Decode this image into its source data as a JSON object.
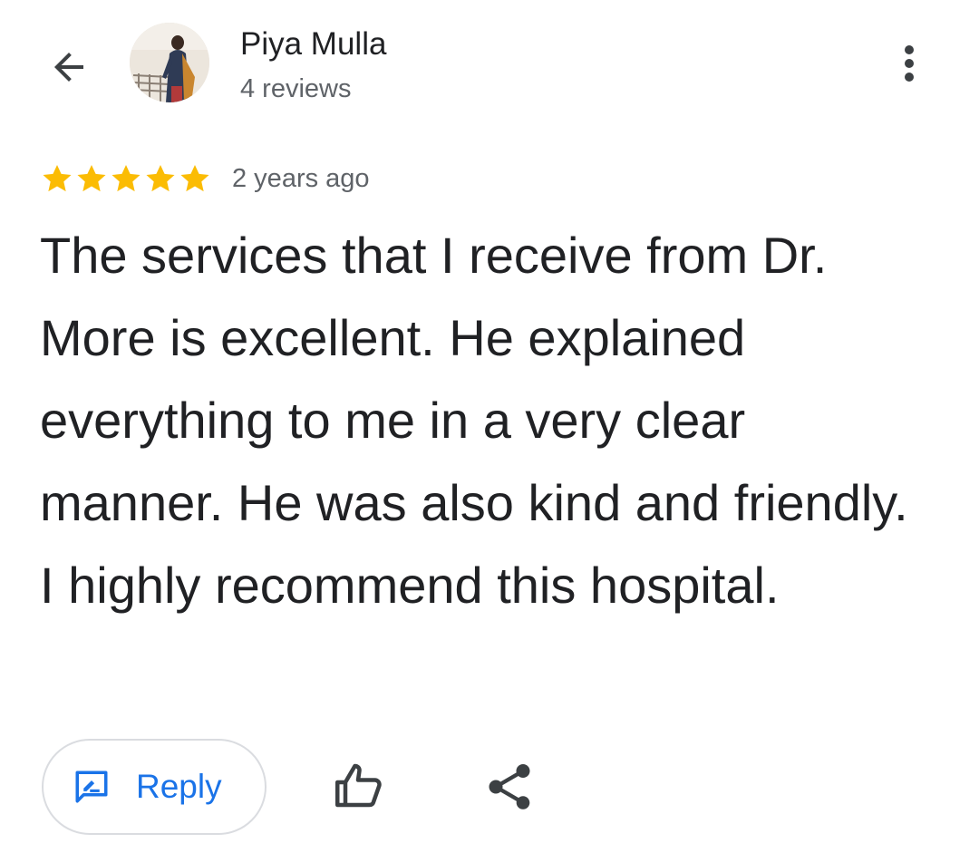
{
  "header": {
    "author_name": "Piya Mulla",
    "author_reviews": "4 reviews",
    "back_icon": "arrow-back-icon",
    "more_icon": "more-vert-icon"
  },
  "review": {
    "rating": 5,
    "rating_max": 5,
    "date": "2 years ago",
    "text": "The services that I receive from Dr. More is excellent. He explained everything to me in a very clear manner. He was also kind and friendly. I highly recommend this hospital."
  },
  "actions": {
    "reply_label": "Reply",
    "reply_icon": "rate-review-icon",
    "like_icon": "thumb-up-icon",
    "share_icon": "share-icon"
  },
  "colors": {
    "star": "#fbbc04",
    "accent": "#1a73e8",
    "text_primary": "#202124",
    "text_secondary": "#5f6368",
    "border": "#dadce0"
  }
}
